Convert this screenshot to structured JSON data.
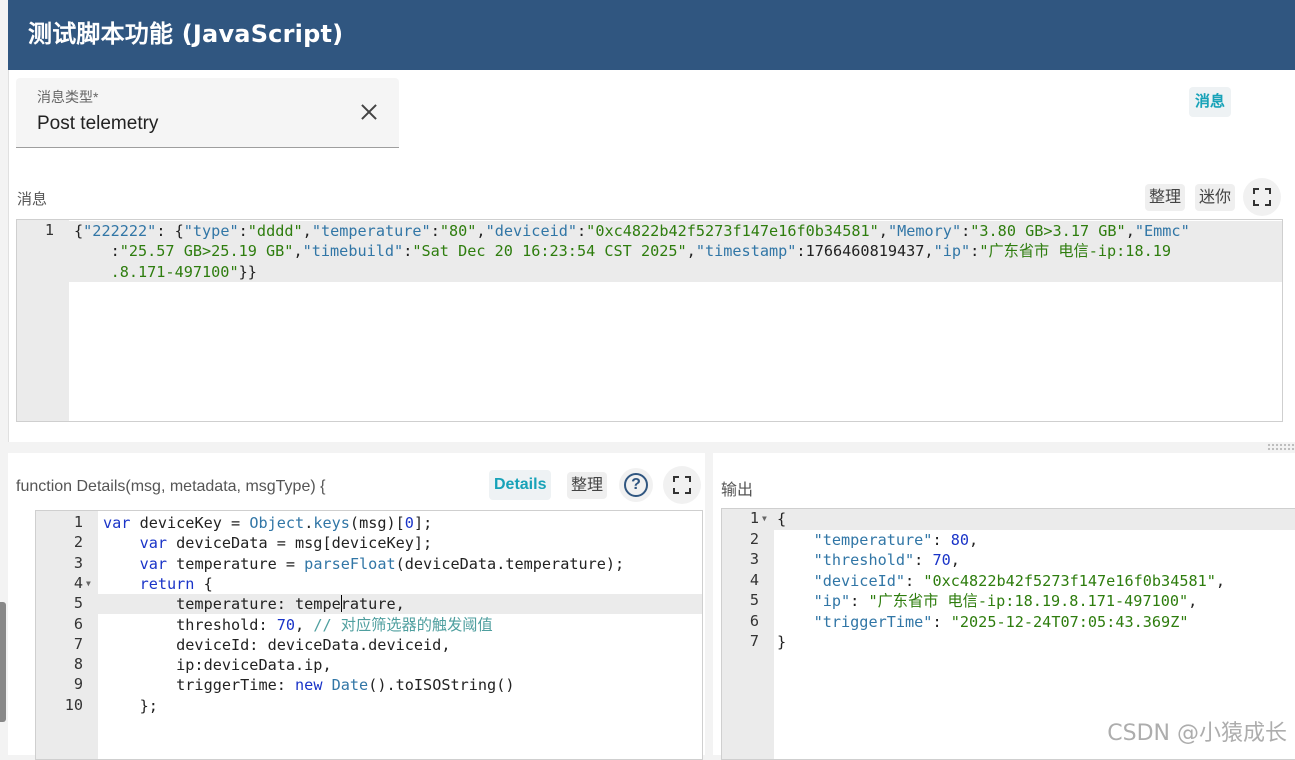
{
  "header": {
    "title": "测试脚本功能 (JavaScript)"
  },
  "message_type": {
    "label": "消息类型*",
    "value": "Post telemetry",
    "toggle_label": "消息"
  },
  "message": {
    "label": "消息",
    "buttons": {
      "tidy": "整理",
      "mini": "迷你"
    },
    "lines": [
      {
        "num": "1",
        "segments": [
          {
            "t": "{",
            "c": "txt"
          },
          {
            "t": "\"222222\"",
            "c": "key"
          },
          {
            "t": ": {",
            "c": "txt"
          },
          {
            "t": "\"type\"",
            "c": "key"
          },
          {
            "t": ":",
            "c": "txt"
          },
          {
            "t": "\"dddd\"",
            "c": "str"
          },
          {
            "t": ",",
            "c": "txt"
          },
          {
            "t": "\"temperature\"",
            "c": "key"
          },
          {
            "t": ":",
            "c": "txt"
          },
          {
            "t": "\"80\"",
            "c": "str"
          },
          {
            "t": ",",
            "c": "txt"
          },
          {
            "t": "\"deviceid\"",
            "c": "key"
          },
          {
            "t": ":",
            "c": "txt"
          },
          {
            "t": "\"0xc4822b42f5273f147e16f0b34581\"",
            "c": "str"
          },
          {
            "t": ",",
            "c": "txt"
          },
          {
            "t": "\"Memory\"",
            "c": "key"
          },
          {
            "t": ":",
            "c": "txt"
          },
          {
            "t": "\"3.80 GB>3.17 GB\"",
            "c": "str"
          },
          {
            "t": ",",
            "c": "txt"
          },
          {
            "t": "\"Emmc\"",
            "c": "key"
          }
        ]
      },
      {
        "num": "",
        "segments": [
          {
            "t": "    :",
            "c": "txt"
          },
          {
            "t": "\"25.57 GB>25.19 GB\"",
            "c": "str"
          },
          {
            "t": ",",
            "c": "txt"
          },
          {
            "t": "\"timebuild\"",
            "c": "key"
          },
          {
            "t": ":",
            "c": "txt"
          },
          {
            "t": "\"Sat Dec 20 16:23:54 CST 2025\"",
            "c": "str"
          },
          {
            "t": ",",
            "c": "txt"
          },
          {
            "t": "\"timestamp\"",
            "c": "key"
          },
          {
            "t": ":1766460819437,",
            "c": "txt"
          },
          {
            "t": "\"ip\"",
            "c": "key"
          },
          {
            "t": ":",
            "c": "txt"
          },
          {
            "t": "\"广东省市 电信-ip:18.19",
            "c": "str"
          }
        ]
      },
      {
        "num": "",
        "segments": [
          {
            "t": "    .8.171-497100\"",
            "c": "str"
          },
          {
            "t": "}}",
            "c": "txt"
          }
        ]
      }
    ]
  },
  "function": {
    "signature": "function Details(msg, metadata, msgType) {",
    "details_label": "Details",
    "tidy_label": "整理",
    "help_glyph": "?",
    "lines": [
      {
        "num": "1",
        "segments": [
          {
            "t": "var ",
            "c": "kw"
          },
          {
            "t": "deviceKey = ",
            "c": "txt"
          },
          {
            "t": "Object",
            "c": "fn"
          },
          {
            "t": ".",
            "c": "txt"
          },
          {
            "t": "keys",
            "c": "fn"
          },
          {
            "t": "(msg)[",
            "c": "txt"
          },
          {
            "t": "0",
            "c": "num"
          },
          {
            "t": "];",
            "c": "txt"
          }
        ]
      },
      {
        "num": "2",
        "segments": [
          {
            "t": "    ",
            "c": "txt"
          },
          {
            "t": "var ",
            "c": "kw"
          },
          {
            "t": "deviceData = msg[deviceKey];",
            "c": "txt"
          }
        ]
      },
      {
        "num": "3",
        "segments": [
          {
            "t": "    ",
            "c": "txt"
          },
          {
            "t": "var ",
            "c": "kw"
          },
          {
            "t": "temperature = ",
            "c": "txt"
          },
          {
            "t": "parseFloat",
            "c": "fn"
          },
          {
            "t": "(deviceData.temperature);",
            "c": "txt"
          }
        ]
      },
      {
        "num": "4",
        "segments": [
          {
            "t": "    ",
            "c": "txt"
          },
          {
            "t": "return",
            "c": "kw"
          },
          {
            "t": " {",
            "c": "txt"
          }
        ]
      },
      {
        "num": "5",
        "segments": [
          {
            "t": "        temperature: tempe",
            "c": "txt"
          },
          {
            "t": "rature,",
            "c": "txt"
          }
        ]
      },
      {
        "num": "6",
        "segments": [
          {
            "t": "        threshold: ",
            "c": "txt"
          },
          {
            "t": "70",
            "c": "num"
          },
          {
            "t": ", ",
            "c": "txt"
          },
          {
            "t": "// 对应筛选器的触发阈值",
            "c": "cm"
          }
        ]
      },
      {
        "num": "7",
        "segments": [
          {
            "t": "        deviceId: deviceData.deviceid,",
            "c": "txt"
          }
        ]
      },
      {
        "num": "8",
        "segments": [
          {
            "t": "        ip:deviceData.ip,",
            "c": "txt"
          }
        ]
      },
      {
        "num": "9",
        "segments": [
          {
            "t": "        triggerTime: ",
            "c": "txt"
          },
          {
            "t": "new ",
            "c": "kw"
          },
          {
            "t": "Date",
            "c": "fn"
          },
          {
            "t": "().toISOString()",
            "c": "txt"
          }
        ]
      },
      {
        "num": "10",
        "segments": [
          {
            "t": "    };",
            "c": "txt"
          }
        ]
      }
    ]
  },
  "output": {
    "label": "输出",
    "lines": [
      {
        "num": "1",
        "segments": [
          {
            "t": "{",
            "c": "txt"
          }
        ]
      },
      {
        "num": "2",
        "segments": [
          {
            "t": "    ",
            "c": "txt"
          },
          {
            "t": "\"temperature\"",
            "c": "key"
          },
          {
            "t": ": ",
            "c": "txt"
          },
          {
            "t": "80",
            "c": "num"
          },
          {
            "t": ",",
            "c": "txt"
          }
        ]
      },
      {
        "num": "3",
        "segments": [
          {
            "t": "    ",
            "c": "txt"
          },
          {
            "t": "\"threshold\"",
            "c": "key"
          },
          {
            "t": ": ",
            "c": "txt"
          },
          {
            "t": "70",
            "c": "num"
          },
          {
            "t": ",",
            "c": "txt"
          }
        ]
      },
      {
        "num": "4",
        "segments": [
          {
            "t": "    ",
            "c": "txt"
          },
          {
            "t": "\"deviceId\"",
            "c": "key"
          },
          {
            "t": ": ",
            "c": "txt"
          },
          {
            "t": "\"0xc4822b42f5273f147e16f0b34581\"",
            "c": "str"
          },
          {
            "t": ",",
            "c": "txt"
          }
        ]
      },
      {
        "num": "5",
        "segments": [
          {
            "t": "    ",
            "c": "txt"
          },
          {
            "t": "\"ip\"",
            "c": "key"
          },
          {
            "t": ": ",
            "c": "txt"
          },
          {
            "t": "\"广东省市 电信-ip:18.19.8.171-497100\"",
            "c": "str"
          },
          {
            "t": ",",
            "c": "txt"
          }
        ]
      },
      {
        "num": "6",
        "segments": [
          {
            "t": "    ",
            "c": "txt"
          },
          {
            "t": "\"triggerTime\"",
            "c": "key"
          },
          {
            "t": ": ",
            "c": "txt"
          },
          {
            "t": "\"2025-12-24T07:05:43.369Z\"",
            "c": "str"
          }
        ]
      },
      {
        "num": "7",
        "segments": [
          {
            "t": "}",
            "c": "txt"
          }
        ]
      }
    ]
  },
  "watermark": "CSDN @小猿成长"
}
